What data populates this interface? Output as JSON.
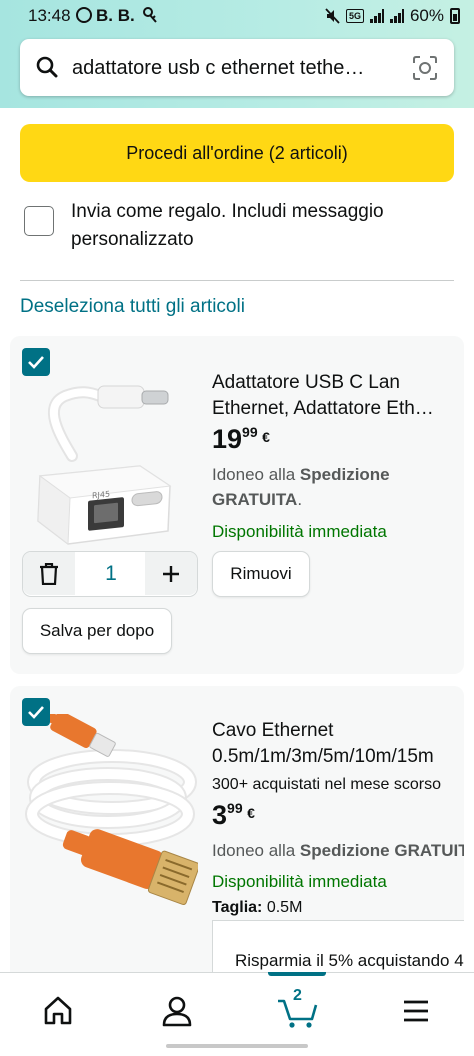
{
  "status_bar": {
    "time": "13:48",
    "notif": "B. B.",
    "network": "5G",
    "battery": "60%"
  },
  "search": {
    "query": "adattatore usb c ethernet tethe…",
    "icon": "search-icon",
    "camera_icon": "camera-scan-icon"
  },
  "checkout": {
    "label": "Procedi all'ordine (2 articoli)"
  },
  "gift": {
    "label": "Invia come regalo. Includi messaggio personalizzato",
    "checked": false
  },
  "deselect_all": "Deseleziona tutti gli articoli",
  "items": [
    {
      "checked": true,
      "title_line1": "Adattatore USB C Lan",
      "title_line2": "Ethernet, Adattatore Eth…",
      "price_whole": "19",
      "price_cents": "99",
      "currency": "€",
      "ship_prefix": "Idoneo alla ",
      "ship_bold": "Spedizione",
      "ship_line2_bold": "GRATUITA",
      "ship_line2_tail": ".",
      "availability": "Disponibilità immediata",
      "quantity": "1",
      "remove_label": "Rimuovi",
      "save_later_label": "Salva per dopo",
      "jack_label": "RJ45"
    },
    {
      "checked": true,
      "title_line1": "Cavo Ethernet",
      "title_line2": "0.5m/1m/3m/5m/10m/15m",
      "bought": "300+ acquistati nel mese scorso",
      "price_whole": "3",
      "price_cents": "99",
      "currency": "€",
      "ship_prefix": "Idoneo alla ",
      "ship_bold": "Spedizione GRATUITA",
      "availability": "Disponibilità immediata",
      "size_label": "Taglia:",
      "size_value": "0.5M",
      "save_offer": "Risparmia il 5% acquistando 4"
    }
  ],
  "bottom_nav": {
    "items": [
      "home-icon",
      "account-icon",
      "cart-icon",
      "menu-icon"
    ],
    "cart_count": "2",
    "active": "cart-icon"
  },
  "colors": {
    "header_gradient": "#a6e5e0",
    "checkout_yellow": "#ffd814",
    "link_teal": "#007185",
    "in_stock_green": "#007600",
    "cable_orange": "#e8772e"
  }
}
